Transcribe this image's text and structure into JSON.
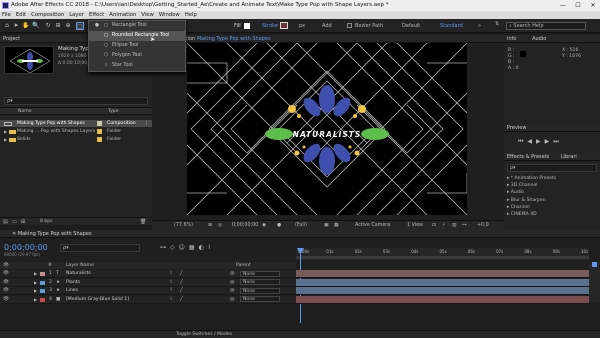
{
  "window": {
    "title": "Adobe After Effects CC 2018 - C:\\Users\\ian\\Desktop\\Getting_Started_Ae\\Create and Animate Text\\Make Type Pop with Shape Layers.aep *",
    "minimize": "—",
    "maximize": "☐",
    "close": "✕"
  },
  "menu": [
    "File",
    "Edit",
    "Composition",
    "Layer",
    "Effect",
    "Animation",
    "View",
    "Window",
    "Help"
  ],
  "toolbar": {
    "fill_label": "Fill",
    "stroke_label": "Stroke",
    "px_label": "px",
    "add_label": "Add",
    "bezier_label": "Bezier Path",
    "workspaces": [
      "Default",
      "Standard"
    ],
    "search_placeholder": "Search Help"
  },
  "shape_menu": {
    "items": [
      "Rectangle Tool",
      "Rounded Rectangle Tool",
      "Ellipse Tool",
      "Polygon Tool",
      "Star Tool"
    ],
    "selected_index": 1
  },
  "project": {
    "tab": "Project",
    "comp_name": "Making Type",
    "comp_info": [
      "1920 x 1080 (1.00)",
      "Δ 0;00;10;00, 29.97 fps"
    ],
    "search_placeholder": "ρ▾",
    "columns": [
      "Name",
      "Type"
    ],
    "items": [
      {
        "name": "Making Type Pop with Shapes",
        "type": "Composition",
        "color": "#c7c7a3",
        "kind": "comp",
        "selected": true
      },
      {
        "name": "Making ... Pop with Shapes Layers",
        "type": "Folder",
        "color": "#e6c04a",
        "kind": "folder",
        "selected": false
      },
      {
        "name": "Solids",
        "type": "Folder",
        "color": "#e6c04a",
        "kind": "folder",
        "selected": false
      }
    ],
    "bpc": "8 bpc"
  },
  "composition": {
    "tab_prefix": "Composition",
    "tab_name": "Making Type Pop with Shapes",
    "sub_tab": "Making Type Pop with Shapes",
    "logo_text": "NATURALISTS",
    "zoom": "(77.6%)",
    "timecode": "0;00;00;00",
    "resolution": "(Full)",
    "camera": "Active Camera",
    "views": "1 View",
    "exposure": "+0.0"
  },
  "colors": {
    "leaf_blue": "#3f4fae",
    "leaf_green": "#5bbf4a",
    "dot_yellow": "#f2c63c",
    "ae_blue": "#5b9bf0",
    "lines": "#cfcfcf"
  },
  "info_panel": {
    "tabs": [
      "Info",
      "Audio"
    ],
    "labels": [
      "R :",
      "G :",
      "B :",
      "A : 0"
    ],
    "coords": [
      "X : 516",
      "Y : 1076"
    ]
  },
  "preview_panel": {
    "tab": "Preview"
  },
  "effects_panel": {
    "tabs": [
      "Effects & Presets",
      "Librari"
    ],
    "search_placeholder": "ρ▾",
    "items": [
      "* Animation Presets",
      "3D Channel",
      "Audio",
      "Blur & Sharpen",
      "Channel",
      "CINEMA 4D"
    ]
  },
  "timeline": {
    "tab": "Making Type Pop with Shapes",
    "timecode": "0;00;00;00",
    "frame_info": "00000 (29.97 fps)",
    "columns": {
      "num": "#",
      "name": "Layer Name",
      "parent": "Parent"
    },
    "layers": [
      {
        "num": "1",
        "name": "Naturalists",
        "type": "text",
        "color": "#c98d8d",
        "parent": "None",
        "bar": "#7a5a5a"
      },
      {
        "num": "2",
        "name": "Plants",
        "type": "shape",
        "color": "#5d9be0",
        "parent": "None",
        "bar": "#58728f"
      },
      {
        "num": "3",
        "name": "Lines",
        "type": "shape",
        "color": "#5d9be0",
        "parent": "None",
        "bar": "#58728f"
      },
      {
        "num": "4",
        "name": "[Medium Gray-Blue Solid 1]",
        "type": "solid",
        "color": "#c84a4a",
        "parent": "None",
        "bar": "#7a4e4e"
      }
    ],
    "ruler": [
      "0:00s",
      "01s",
      "02s",
      "03s",
      "04s",
      "05s",
      "06s",
      "07s",
      "08s",
      "09s",
      "10s"
    ],
    "footer": "Toggle Switches / Modes"
  }
}
